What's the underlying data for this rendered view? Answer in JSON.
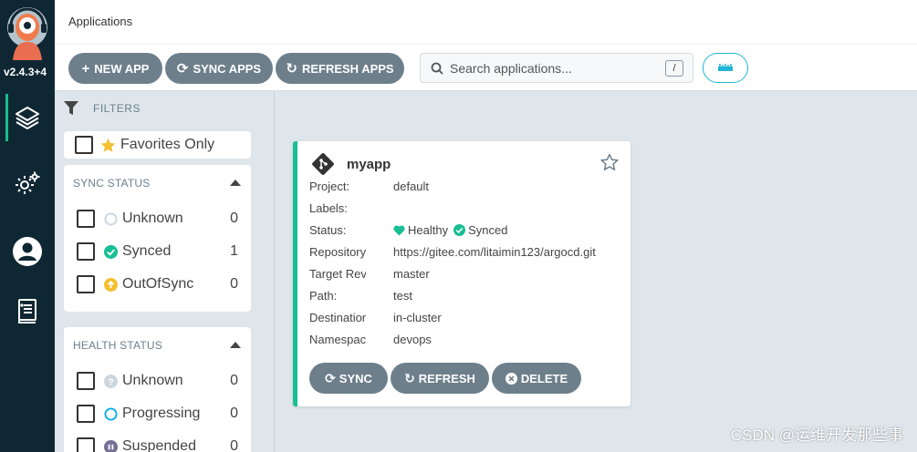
{
  "nav": {
    "version": "v2.4.3+4",
    "items": [
      {
        "name": "applications",
        "icon": "layers-icon"
      },
      {
        "name": "settings",
        "icon": "gears-icon"
      },
      {
        "name": "user-info",
        "icon": "user-icon"
      },
      {
        "name": "docs",
        "icon": "book-icon"
      }
    ]
  },
  "header": {
    "title": "Applications"
  },
  "toolbar": {
    "new_app": "NEW APP",
    "sync_apps": "SYNC APPS",
    "refresh_apps": "REFRESH APPS",
    "search_placeholder": "Search applications...",
    "search_shortcut": "/"
  },
  "filters": {
    "title": "FILTERS",
    "favorites_label": "Favorites Only",
    "sync_status": {
      "title": "SYNC STATUS",
      "items": [
        {
          "label": "Unknown",
          "count": "0",
          "icon": "circle-outline-icon"
        },
        {
          "label": "Synced",
          "count": "1",
          "icon": "check-circle-icon"
        },
        {
          "label": "OutOfSync",
          "count": "0",
          "icon": "arrow-up-circle-icon"
        }
      ]
    },
    "health_status": {
      "title": "HEALTH STATUS",
      "items": [
        {
          "label": "Unknown",
          "count": "0",
          "icon": "question-circle-icon"
        },
        {
          "label": "Progressing",
          "count": "0",
          "icon": "spinner-circle-icon"
        },
        {
          "label": "Suspended",
          "count": "0",
          "icon": "pause-circle-icon"
        }
      ]
    }
  },
  "app": {
    "name": "myapp",
    "fields": [
      {
        "key": "Project:",
        "value": "default"
      },
      {
        "key": "Labels:",
        "value": ""
      },
      {
        "key": "Status:",
        "health": "Healthy",
        "sync": "Synced"
      },
      {
        "key": "Repository:",
        "value": "https://gitee.com/litaimin123/argocd.git"
      },
      {
        "key": "Target Revision:",
        "value": "master"
      },
      {
        "key": "Path:",
        "value": "test"
      },
      {
        "key": "Destination:",
        "value": "in-cluster"
      },
      {
        "key": "Namespace:",
        "value": "devops"
      }
    ],
    "actions": {
      "sync": "SYNC",
      "refresh": "REFRESH",
      "delete": "DELETE"
    }
  },
  "colors": {
    "nav_bg": "#0f2733",
    "button_bg": "#6d7f8b",
    "healthy": "#18be94",
    "outofsync": "#f4c030",
    "accent": "#1fb5d6"
  },
  "watermark": "CSDN @运维开发那些事"
}
